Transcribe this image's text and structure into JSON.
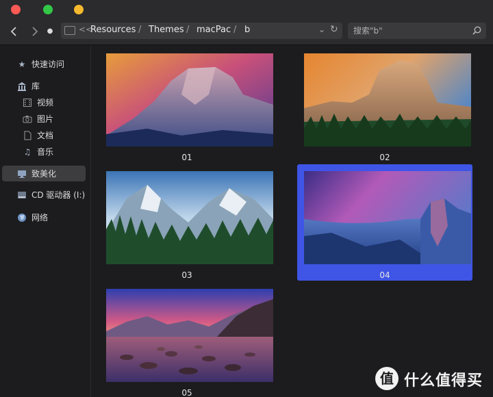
{
  "window": {
    "traffic_lights": {
      "close_color": "#fb5a55",
      "maximize_color": "#33c748",
      "minimize_color": "#f5b82e"
    }
  },
  "toolbar": {
    "back_icon": "chevron-left-icon",
    "forward_icon": "chevron-right-icon",
    "dot": "●",
    "path": {
      "collapse": "<<",
      "crumbs": [
        "Resources",
        "Themes",
        "macPac",
        "b"
      ],
      "separator": "/"
    },
    "search": {
      "placeholder": "搜索\"b\""
    }
  },
  "sidebar": {
    "items": [
      {
        "label": "快速访问",
        "icon": "star-icon"
      },
      {
        "label": "库",
        "icon": "library-icon"
      },
      {
        "label": "视频",
        "icon": "film-icon"
      },
      {
        "label": "图片",
        "icon": "camera-icon"
      },
      {
        "label": "文档",
        "icon": "document-icon"
      },
      {
        "label": "音乐",
        "icon": "music-note-icon"
      },
      {
        "label": "致美化",
        "icon": "monitor-icon"
      },
      {
        "label": "CD 驱动器 (I:)",
        "icon": "disk-drive-icon"
      },
      {
        "label": "网络",
        "icon": "globe-icon"
      }
    ],
    "selected": "致美化"
  },
  "files": [
    {
      "name": "01",
      "selected": false
    },
    {
      "name": "02",
      "selected": false
    },
    {
      "name": "03",
      "selected": false
    },
    {
      "name": "04",
      "selected": true
    },
    {
      "name": "05",
      "selected": false
    }
  ],
  "watermark": {
    "logo_char": "值",
    "text": "什么值得买"
  },
  "accent_color": "#3f55e6"
}
